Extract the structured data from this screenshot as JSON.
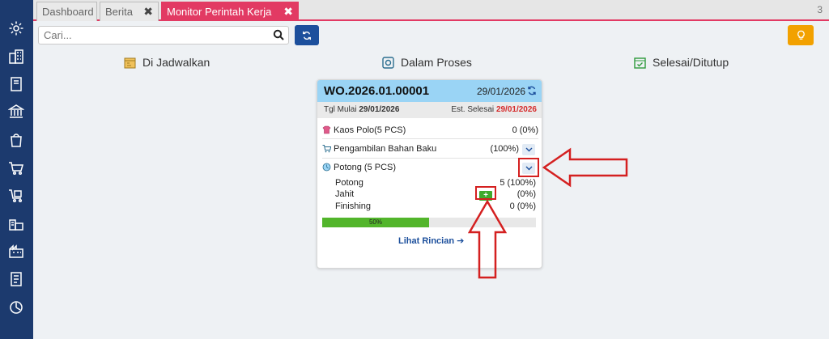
{
  "tabs": [
    {
      "label": "Dashboard",
      "closable": false
    },
    {
      "label": "Berita",
      "closable": true
    },
    {
      "label": "Monitor Perintah Kerja",
      "closable": true,
      "active": true
    }
  ],
  "tab_close_glyph": "✖",
  "tab_count": "3",
  "search": {
    "placeholder": "Cari..."
  },
  "columns": {
    "scheduled": "Di Jadwalkan",
    "in_process": "Dalam Proses",
    "done": "Selesai/Ditutup"
  },
  "card": {
    "title": "WO.2026.01.00001",
    "date": "29/01/2026",
    "start_label": "Tgl Mulai",
    "start_date": "29/01/2026",
    "end_label": "Est. Selesai",
    "end_date": "29/01/2026",
    "items": [
      {
        "label": "Kaos Polo(5 PCS)",
        "value": "0 (0%)",
        "icon": "shirt-icon"
      },
      {
        "label": "Pengambilan Bahan Baku",
        "value": "(100%)",
        "icon": "cart-icon"
      },
      {
        "label": "Potong (5 PCS)",
        "value": "",
        "icon": "process-icon"
      }
    ],
    "sub_items": [
      {
        "label": "Potong",
        "value": "5 (100%)"
      },
      {
        "label": "Jahit",
        "value": "(0%)"
      },
      {
        "label": "Finishing",
        "value": "0 (0%)"
      }
    ],
    "plus_label": "+",
    "progress": {
      "percent": 50,
      "label": "50%"
    },
    "detail_link": "Lihat Rincian ➔"
  },
  "colors": {
    "sidebar": "#1c3a6e",
    "active_tab": "#e23a63",
    "card_header": "#9ad4f5",
    "progress_fill": "#52b52b",
    "annotation": "#d42020"
  }
}
